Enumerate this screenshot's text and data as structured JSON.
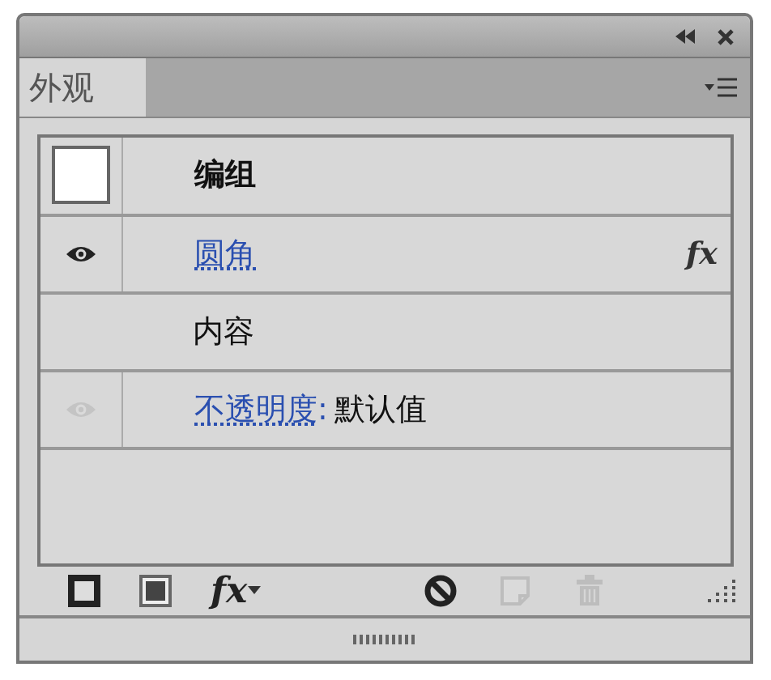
{
  "panel": {
    "tab": {
      "label": "外观",
      "selected": true
    }
  },
  "rows": [
    {
      "kind": "header",
      "title": "编组"
    },
    {
      "kind": "effect",
      "label": "圆角",
      "fx": "fx",
      "dimmed": false
    },
    {
      "kind": "plain",
      "title": "内容"
    },
    {
      "kind": "attribute",
      "label": "不透明度",
      "separator": ":",
      "value": "默认值",
      "dimmed": true
    }
  ],
  "tools": [
    {
      "kind": "stroke",
      "disabled": false
    },
    {
      "kind": "fill",
      "disabled": false
    },
    {
      "kind": "fx",
      "label": "fx",
      "disabled": false
    },
    {
      "kind": "clear",
      "disabled": false
    },
    {
      "kind": "duplicate",
      "disabled": true
    },
    {
      "kind": "delete",
      "disabled": true
    }
  ]
}
